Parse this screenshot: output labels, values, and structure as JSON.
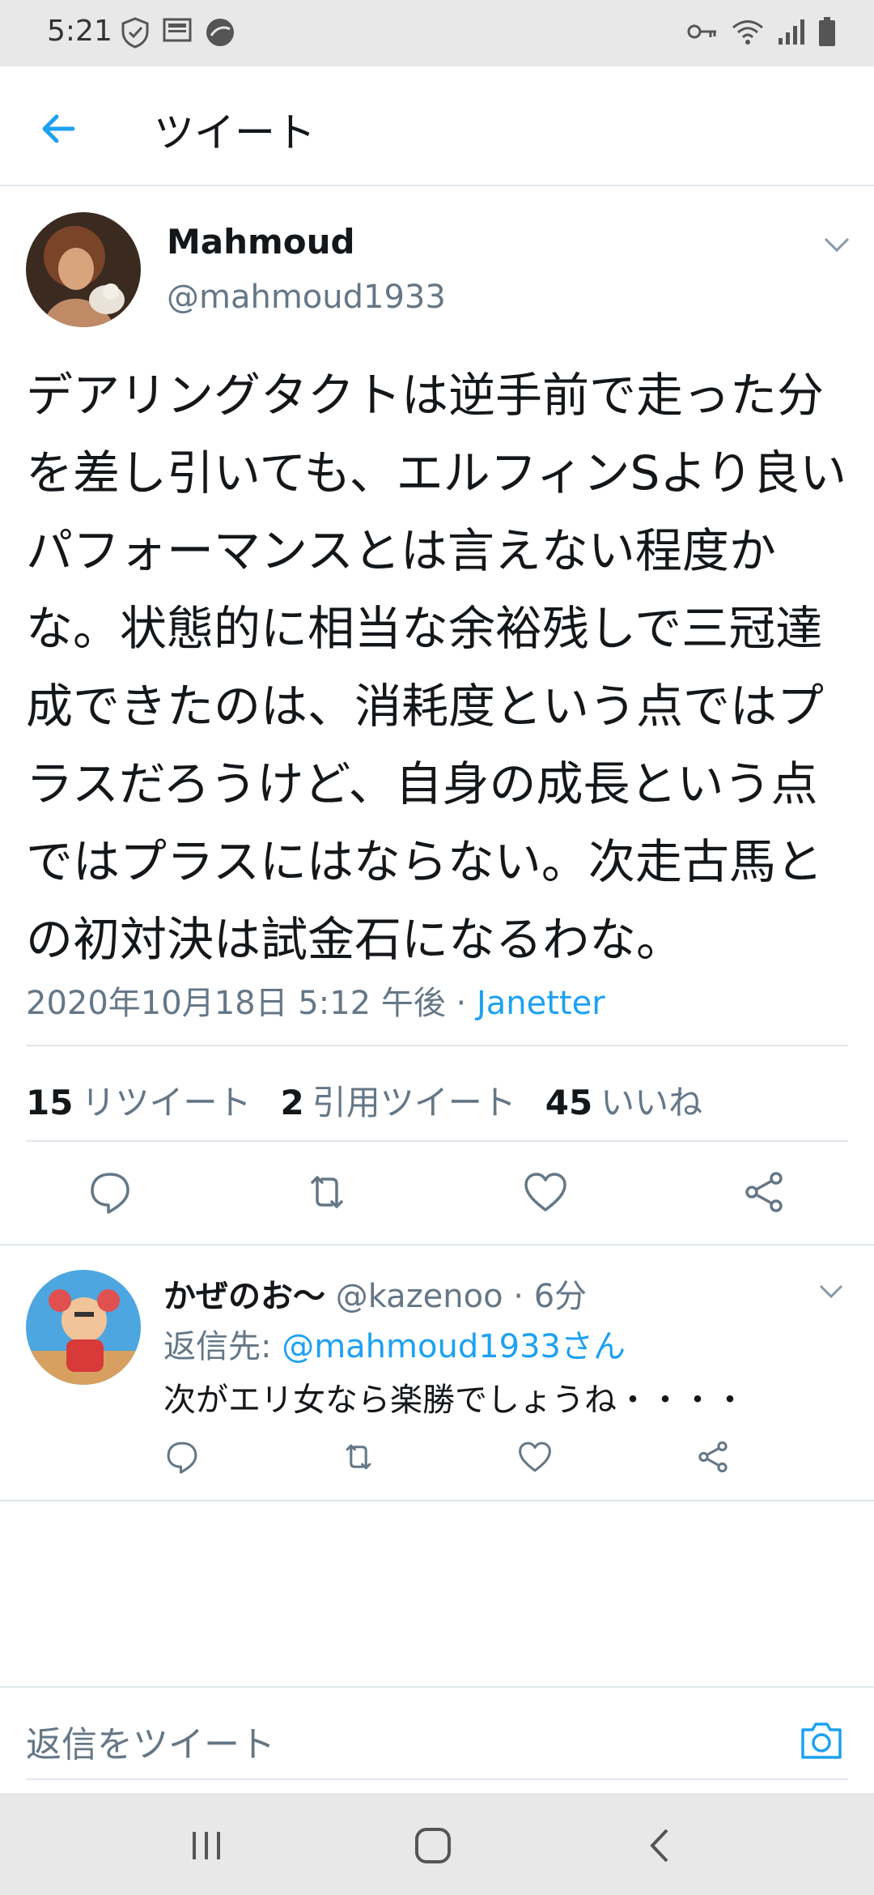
{
  "status_bar": {
    "time": "5:21"
  },
  "header": {
    "title": "ツイート"
  },
  "tweet": {
    "author_name": "Mahmoud",
    "author_handle": "@mahmoud1933",
    "text": "デアリングタクトは逆手前で走った分を差し引いても、エルフィンSより良いパフォーマンスとは言えない程度かな。状態的に相当な余裕残しで三冠達成できたのは、消耗度という点ではプラスだろうけど、自身の成長という点ではプラスにはならない。次走古馬との初対決は試金石になるわな。",
    "timestamp": "2020年10月18日 5:12 午後 · ",
    "client": "Janetter",
    "stats": {
      "retweets": "15",
      "retweets_label": "リツイート",
      "quotes": "2",
      "quotes_label": "引用ツイート",
      "likes": "45",
      "likes_label": "いいね"
    }
  },
  "reply": {
    "author_name": "かぜのお〜",
    "meta": " @kazenoo · 6分",
    "reply_to_label": "返信先: ",
    "reply_to_mention": "@mahmoud1933さん",
    "text": "次がエリ女なら楽勝でしょうね・・・・"
  },
  "compose": {
    "placeholder": "返信をツイート"
  },
  "colors": {
    "accent": "#1da1f2",
    "secondary": "#657786",
    "text": "#14171a",
    "divider": "#e1e8ed"
  }
}
